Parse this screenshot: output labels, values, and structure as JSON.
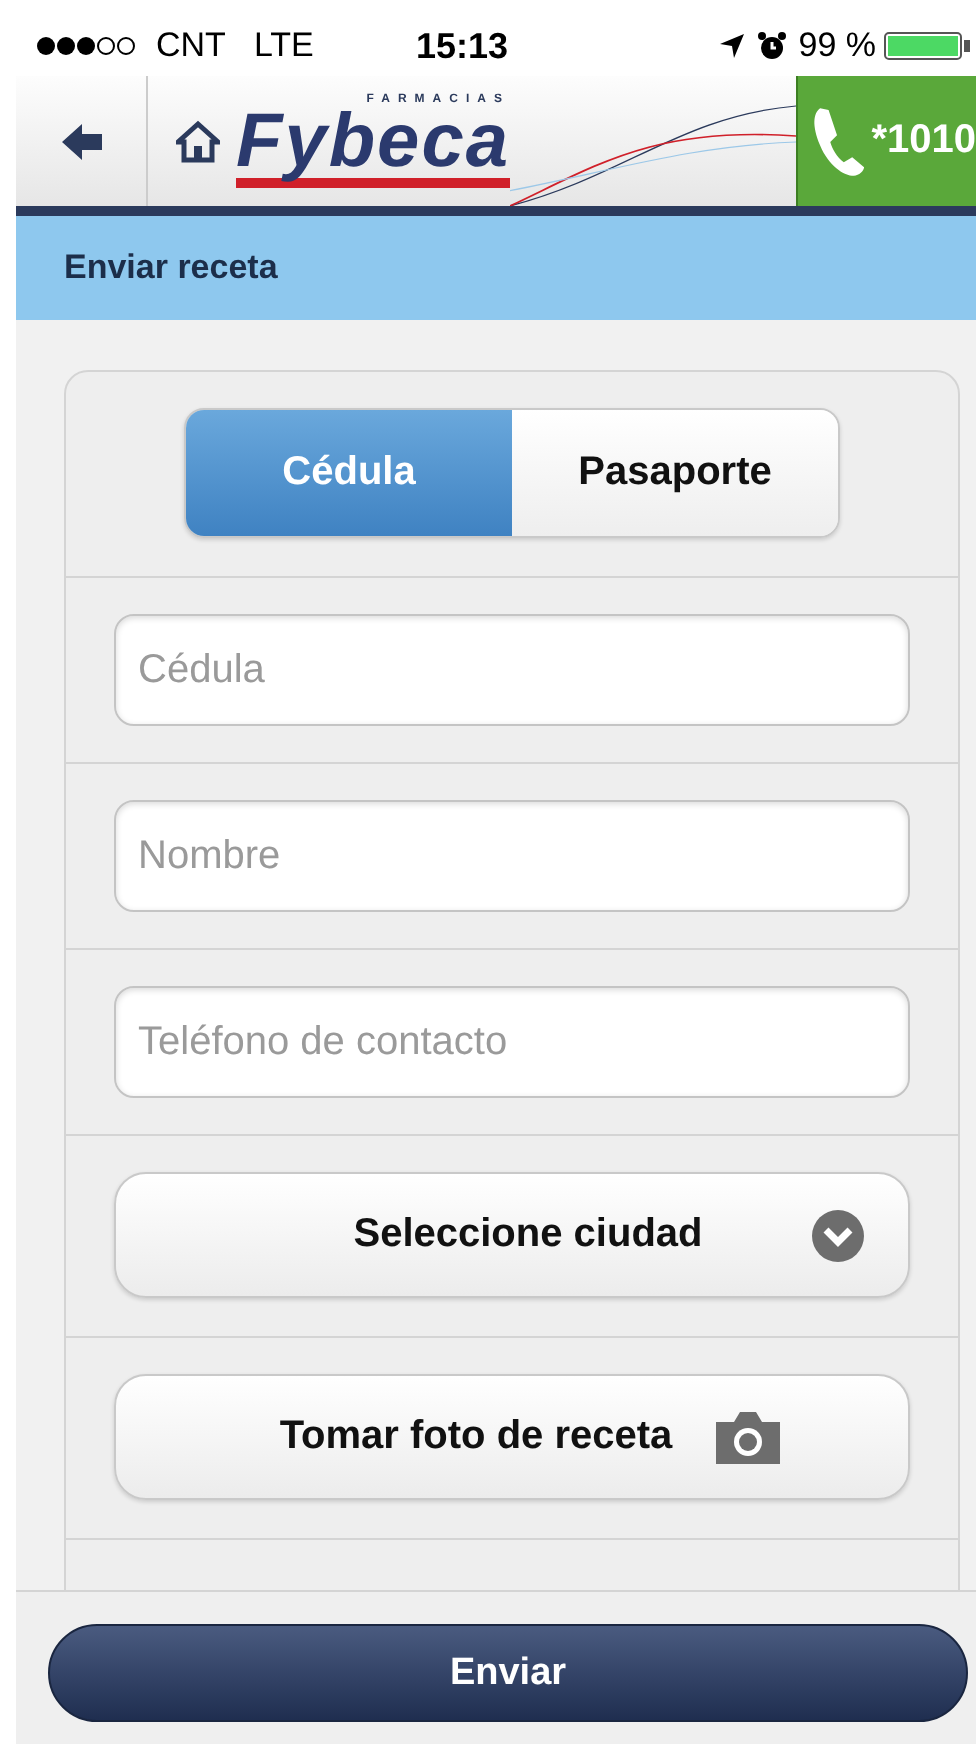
{
  "status_bar": {
    "carrier": "CNT",
    "network": "LTE",
    "time": "15:13",
    "battery": "99 %"
  },
  "header": {
    "logo_small": "FARMACIAS",
    "logo": "Fybeca",
    "phone": "*1010"
  },
  "page_title": "Enviar receta",
  "id_type": [
    {
      "label": "Cédula",
      "selected": true
    },
    {
      "label": "Pasaporte",
      "selected": false
    }
  ],
  "fields": [
    {
      "placeholder": "Cédula"
    },
    {
      "placeholder": "Nombre"
    },
    {
      "placeholder": "Teléfono de contacto"
    }
  ],
  "city_select": {
    "label": "Seleccione ciudad"
  },
  "photo_button": {
    "label": "Tomar foto de receta"
  },
  "submit": {
    "label": "Enviar"
  }
}
